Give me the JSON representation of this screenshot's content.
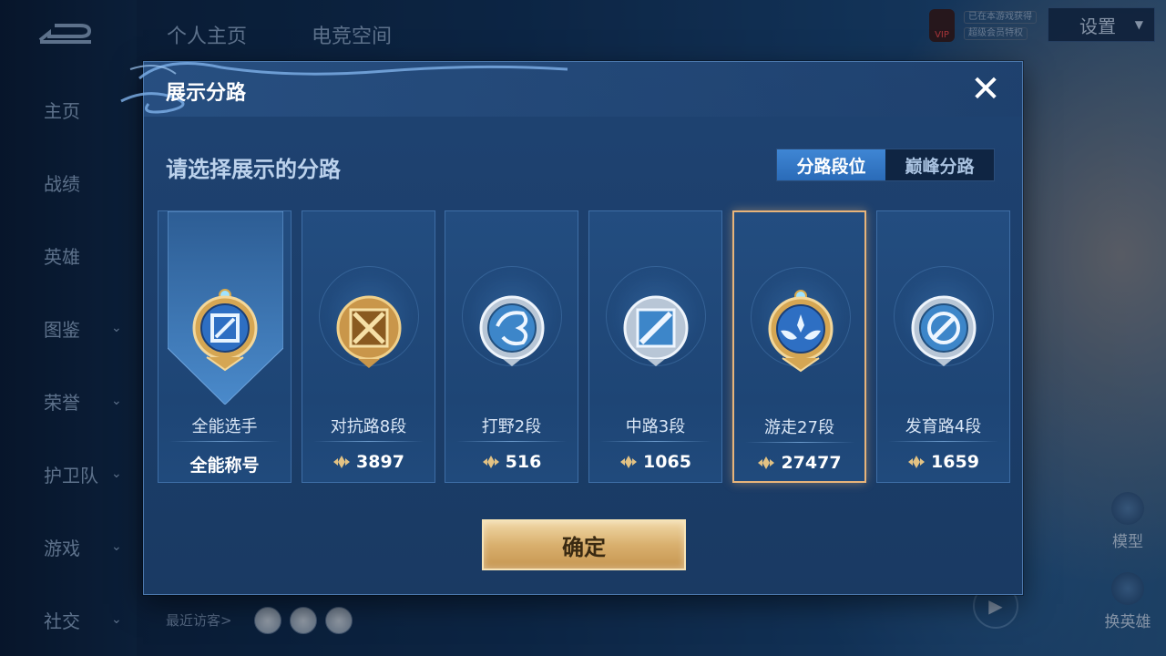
{
  "app": {
    "top_tabs": [
      "个人主页",
      "电竞空间"
    ],
    "sidebar": [
      {
        "label": "主页",
        "active": true,
        "has_submenu": false
      },
      {
        "label": "战绩",
        "active": false,
        "has_submenu": false
      },
      {
        "label": "英雄",
        "active": false,
        "has_submenu": false
      },
      {
        "label": "图鉴",
        "active": false,
        "has_submenu": true
      },
      {
        "label": "荣誉",
        "active": false,
        "has_submenu": true
      },
      {
        "label": "护卫队",
        "active": false,
        "has_submenu": true
      },
      {
        "label": "游戏",
        "active": false,
        "has_submenu": true
      },
      {
        "label": "社交",
        "active": false,
        "has_submenu": true
      }
    ],
    "vip_label": "VIP",
    "vip_lines": [
      "已在本游戏获得",
      "超级会员特权"
    ],
    "settings_label": "设置",
    "right_buttons": [
      "模型",
      "换英雄"
    ],
    "recent_visitors_label": "最近访客>"
  },
  "dialog": {
    "title": "展示分路",
    "subtitle": "请选择展示的分路",
    "toggle": {
      "active": "分路段位",
      "inactive": "巅峰分路"
    },
    "cards": [
      {
        "name": "全能选手",
        "score": "全能称号",
        "selected": false,
        "badge": "all-round-gold-badge",
        "show_icon": false
      },
      {
        "name": "对抗路8段",
        "score": "3897",
        "selected": false,
        "badge": "clash-lane-gold-badge",
        "show_icon": true
      },
      {
        "name": "打野2段",
        "score": "516",
        "selected": false,
        "badge": "jungle-silver-badge",
        "show_icon": true
      },
      {
        "name": "中路3段",
        "score": "1065",
        "selected": false,
        "badge": "mid-lane-silver-badge",
        "show_icon": true
      },
      {
        "name": "游走27段",
        "score": "27477",
        "selected": true,
        "badge": "roam-gold-badge",
        "show_icon": true
      },
      {
        "name": "发育路4段",
        "score": "1659",
        "selected": false,
        "badge": "farm-lane-silver-badge",
        "show_icon": true
      }
    ],
    "confirm_label": "确定"
  },
  "colors": {
    "accent_blue": "#2f77c6",
    "gold": "#d9b06e",
    "selected_border": "#e7b47a"
  }
}
